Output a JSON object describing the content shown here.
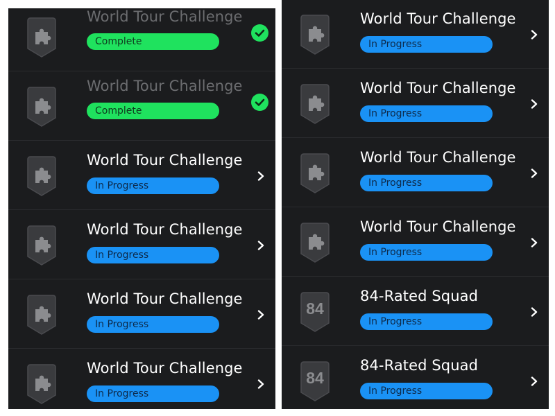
{
  "left_panel": {
    "rows": [
      {
        "title": "World Tour Challenge",
        "status": "Complete",
        "state": "complete",
        "badge": "puzzle-icon"
      },
      {
        "title": "World Tour Challenge",
        "status": "Complete",
        "state": "complete",
        "badge": "puzzle-icon"
      },
      {
        "title": "World Tour Challenge",
        "status": "In Progress",
        "state": "progress",
        "badge": "puzzle-icon"
      },
      {
        "title": "World Tour Challenge",
        "status": "In Progress",
        "state": "progress",
        "badge": "puzzle-icon"
      },
      {
        "title": "World Tour Challenge",
        "status": "In Progress",
        "state": "progress",
        "badge": "puzzle-icon"
      },
      {
        "title": "World Tour Challenge",
        "status": "In Progress",
        "state": "progress",
        "badge": "puzzle-icon"
      }
    ]
  },
  "right_panel": {
    "rows": [
      {
        "title": "World Tour Challenge",
        "status": "In Progress",
        "state": "progress",
        "badge": "puzzle-icon"
      },
      {
        "title": "World Tour Challenge",
        "status": "In Progress",
        "state": "progress",
        "badge": "puzzle-icon"
      },
      {
        "title": "World Tour Challenge",
        "status": "In Progress",
        "state": "progress",
        "badge": "puzzle-icon"
      },
      {
        "title": "World Tour Challenge",
        "status": "In Progress",
        "state": "progress",
        "badge": "puzzle-icon"
      },
      {
        "title": "84-Rated Squad",
        "status": "In Progress",
        "state": "progress",
        "badge": "84"
      },
      {
        "title": "84-Rated Squad",
        "status": "In Progress",
        "state": "progress",
        "badge": "84"
      }
    ]
  },
  "colors": {
    "panel_bg": "#1b1c1e",
    "progress": "#1a92f5",
    "complete": "#1fe25e",
    "badge": "#3a3b3e"
  }
}
